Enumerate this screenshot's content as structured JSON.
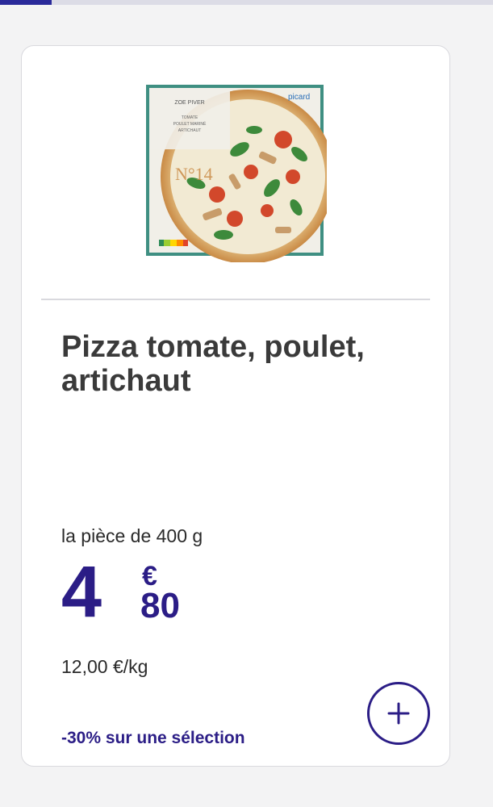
{
  "product": {
    "title": "Pizza tomate, poulet, artichaut",
    "unit_label": "la pièce de 400 g",
    "price": {
      "integer": "4",
      "currency": "€",
      "decimals": "80"
    },
    "price_per_kg": "12,00 €/kg",
    "promo": "-30% sur une sélection",
    "image": {
      "packaging_brand": "picard",
      "packaging_number": "N°14",
      "packaging_text": "TOMATE POULET MARINÉ ARTICHAUT"
    }
  },
  "colors": {
    "brand": "#2b1d86",
    "active_tab": "#2a2a9a",
    "page_background": "#f3f3f4"
  },
  "icons": {
    "add": "plus-icon"
  }
}
